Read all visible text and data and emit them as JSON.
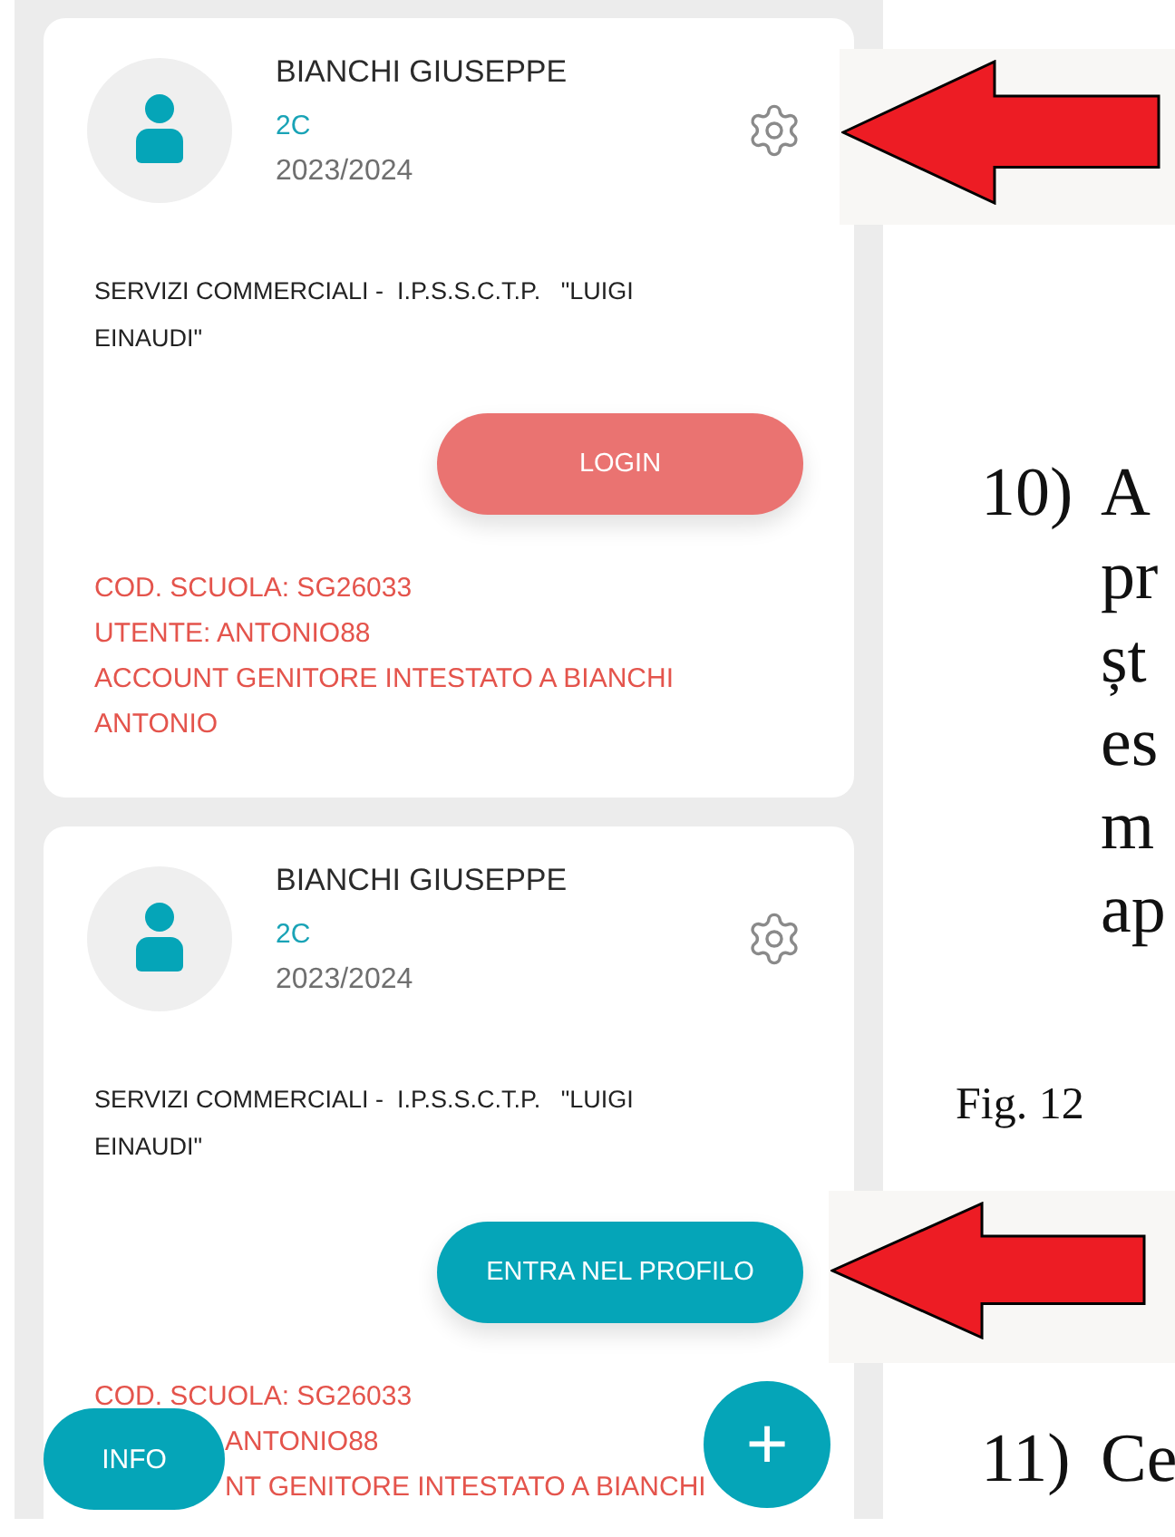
{
  "cards": [
    {
      "name": "BIANCHI GIUSEPPE",
      "class": "2C",
      "year": "2023/2024",
      "school": "SERVIZI COMMERCIALI -  I.P.S.S.C.T.P.   \"LUIGI EINAUDI\"",
      "button": {
        "label": "LOGIN",
        "kind": "login"
      },
      "info": [
        {
          "text": "COD. SCUOLA: SG26033",
          "covered": false
        },
        {
          "text": "UTENTE: ANTONIO88",
          "covered": false
        },
        {
          "text": "ACCOUNT GENITORE INTESTATO A BIANCHI ANTONIO",
          "covered": false
        }
      ]
    },
    {
      "name": "BIANCHI GIUSEPPE",
      "class": "2C",
      "year": "2023/2024",
      "school": "SERVIZI COMMERCIALI -  I.P.S.S.C.T.P.   \"LUIGI EINAUDI\"",
      "button": {
        "label": "ENTRA NEL PROFILO",
        "kind": "enter"
      },
      "info": [
        {
          "text": "COD. SCUOLA: SG26033",
          "covered": false
        },
        {
          "text": "ANTONIO88",
          "covered": true
        },
        {
          "text": "NT GENITORE INTESTATO A BIANCHI",
          "covered": true
        }
      ]
    }
  ],
  "floating_buttons": {
    "info": "INFO",
    "add": "+"
  },
  "document": {
    "step_10": {
      "number": "10)",
      "lines": [
        "A",
        "pr",
        "șt",
        "es",
        "m",
        "ap"
      ]
    },
    "caption": "Fig. 12",
    "step_11": {
      "number": "11)",
      "lines": [
        "Ce"
      ]
    }
  }
}
